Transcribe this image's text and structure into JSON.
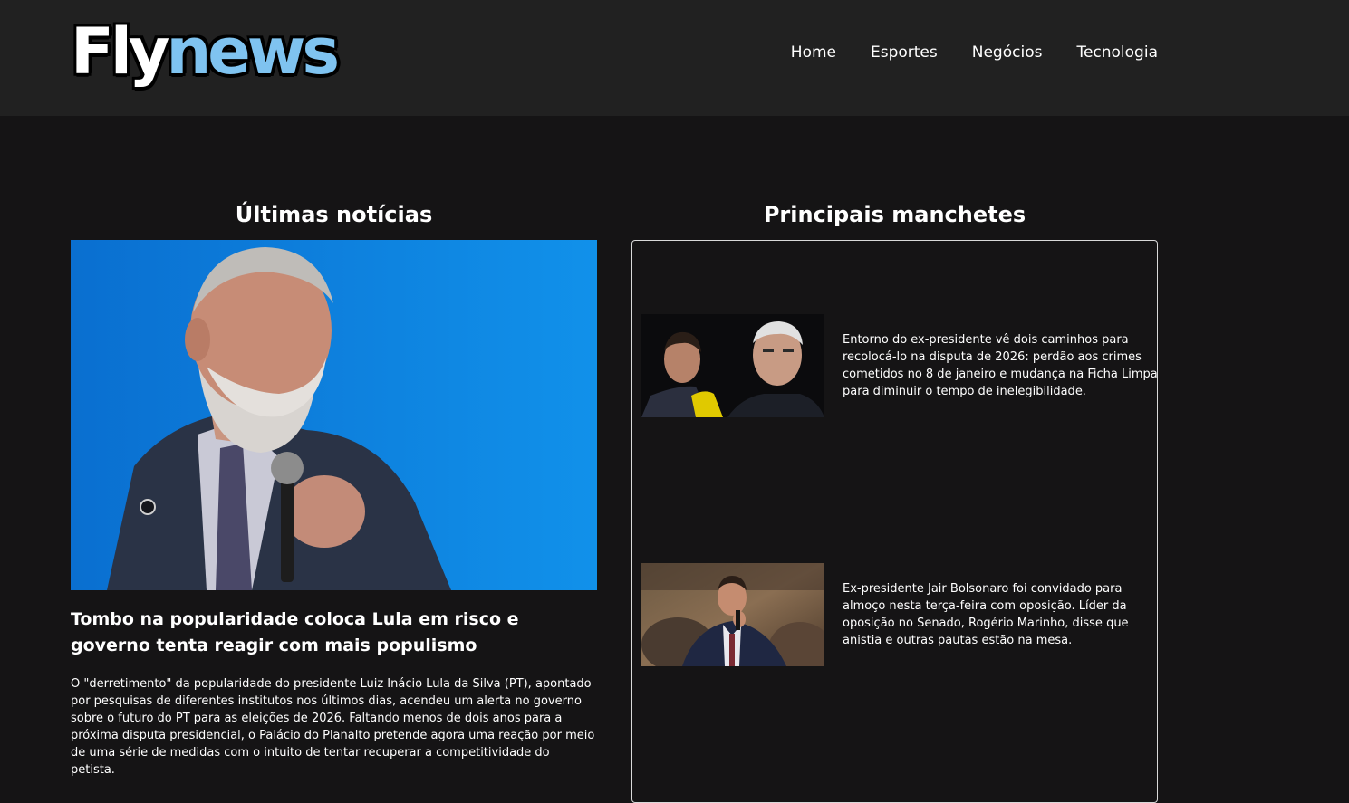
{
  "header": {
    "logo": {
      "part1": "Fly",
      "part2": "news"
    },
    "nav": [
      "Home",
      "Esportes",
      "Negócios",
      "Tecnologia"
    ]
  },
  "latest": {
    "section_title": "Últimas notícias",
    "article": {
      "title": "Tombo na popularidade coloca Lula em risco e governo tenta reagir com mais populismo",
      "summary": "O \"derretimento\" da popularidade do presidente Luiz Inácio Lula da Silva (PT), apontado por pesquisas de diferentes institutos nos últimos dias, acendeu um alerta no governo sobre o futuro do PT para as eleições de 2026. Faltando menos de dois anos para a próxima disputa presidencial, o Palácio do Planalto pretende agora uma reação por meio de uma série de medidas com o intuito de tentar recuperar a competitividade do petista."
    }
  },
  "headlines": {
    "section_title": "Principais manchetes",
    "items": [
      {
        "text": "Entorno do ex-presidente vê dois caminhos para recolocá-lo na disputa de 2026: perdão aos crimes cometidos no 8 de janeiro e mudança na Ficha Limpa para diminuir o tempo de inelegibilidade."
      },
      {
        "text": "Ex-presidente Jair Bolsonaro foi convidado para almoço nesta terça-feira com oposição. Líder da oposição no Senado, Rogério Marinho, disse que anistia e outras pautas estão na mesa."
      }
    ]
  },
  "colors": {
    "page_bg": "#151415",
    "header_bg": "#212121",
    "logo_accent": "#7fc3f0",
    "hero_bg": "#0d8be8"
  }
}
